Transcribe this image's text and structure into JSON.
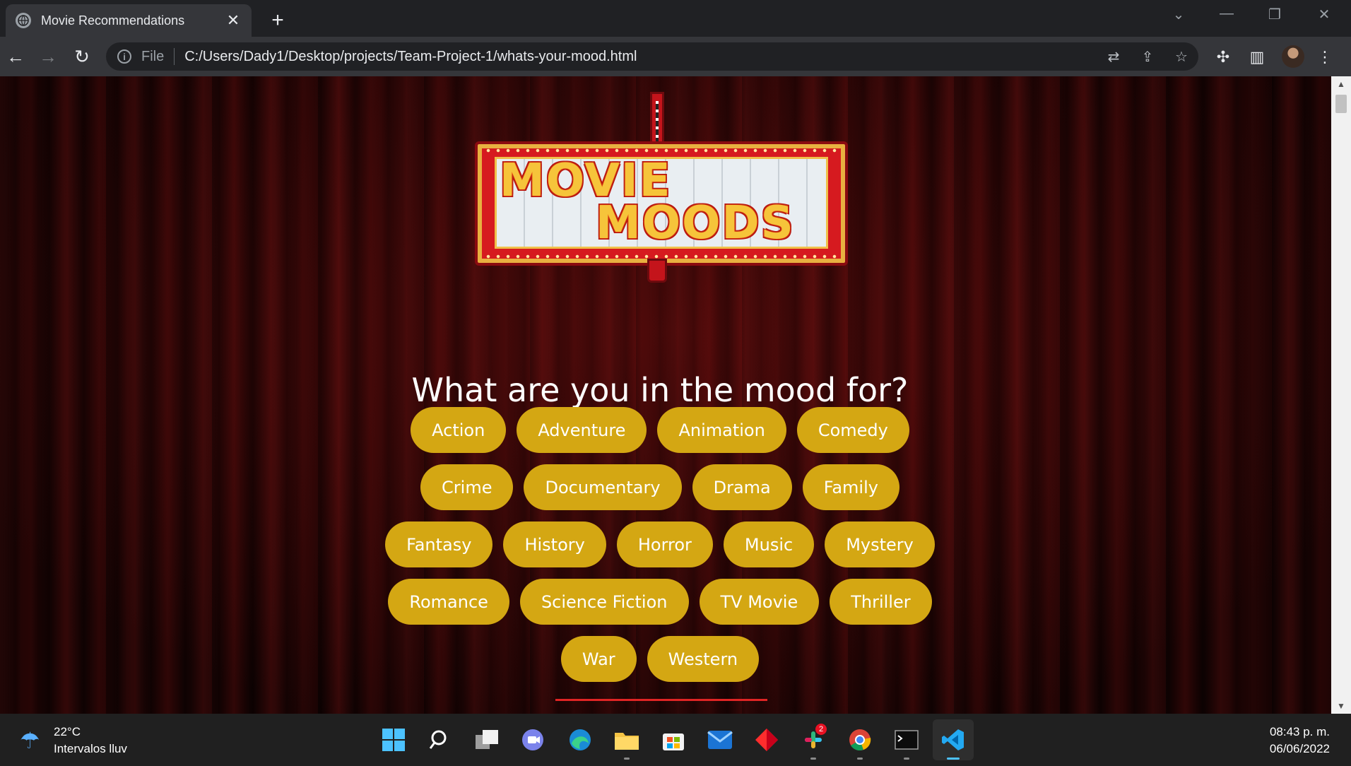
{
  "browser": {
    "tab_title": "Movie Recommendations",
    "tab_close": "✕",
    "new_tab": "+",
    "scheme_label": "File",
    "url": "C:/Users/Dady1/Desktop/projects/Team-Project-1/whats-your-mood.html"
  },
  "page": {
    "logo_words": [
      "MOVIE",
      "MOODS"
    ],
    "heading": "What are you in the mood for?",
    "genres": [
      [
        "Action",
        "Adventure",
        "Animation",
        "Comedy"
      ],
      [
        "Crime",
        "Documentary",
        "Drama",
        "Family"
      ],
      [
        "Fantasy",
        "History",
        "Horror",
        "Music",
        "Mystery"
      ],
      [
        "Romance",
        "Science Fiction",
        "TV Movie",
        "Thriller"
      ],
      [
        "War",
        "Western"
      ]
    ],
    "pill_color": "#d4a713",
    "divider_color": "#e02424"
  },
  "taskbar": {
    "temperature": "22°C",
    "weather_text": "Intervalos lluv",
    "slack_badge": "2",
    "time": "08:43 p. m.",
    "date": "06/06/2022"
  }
}
